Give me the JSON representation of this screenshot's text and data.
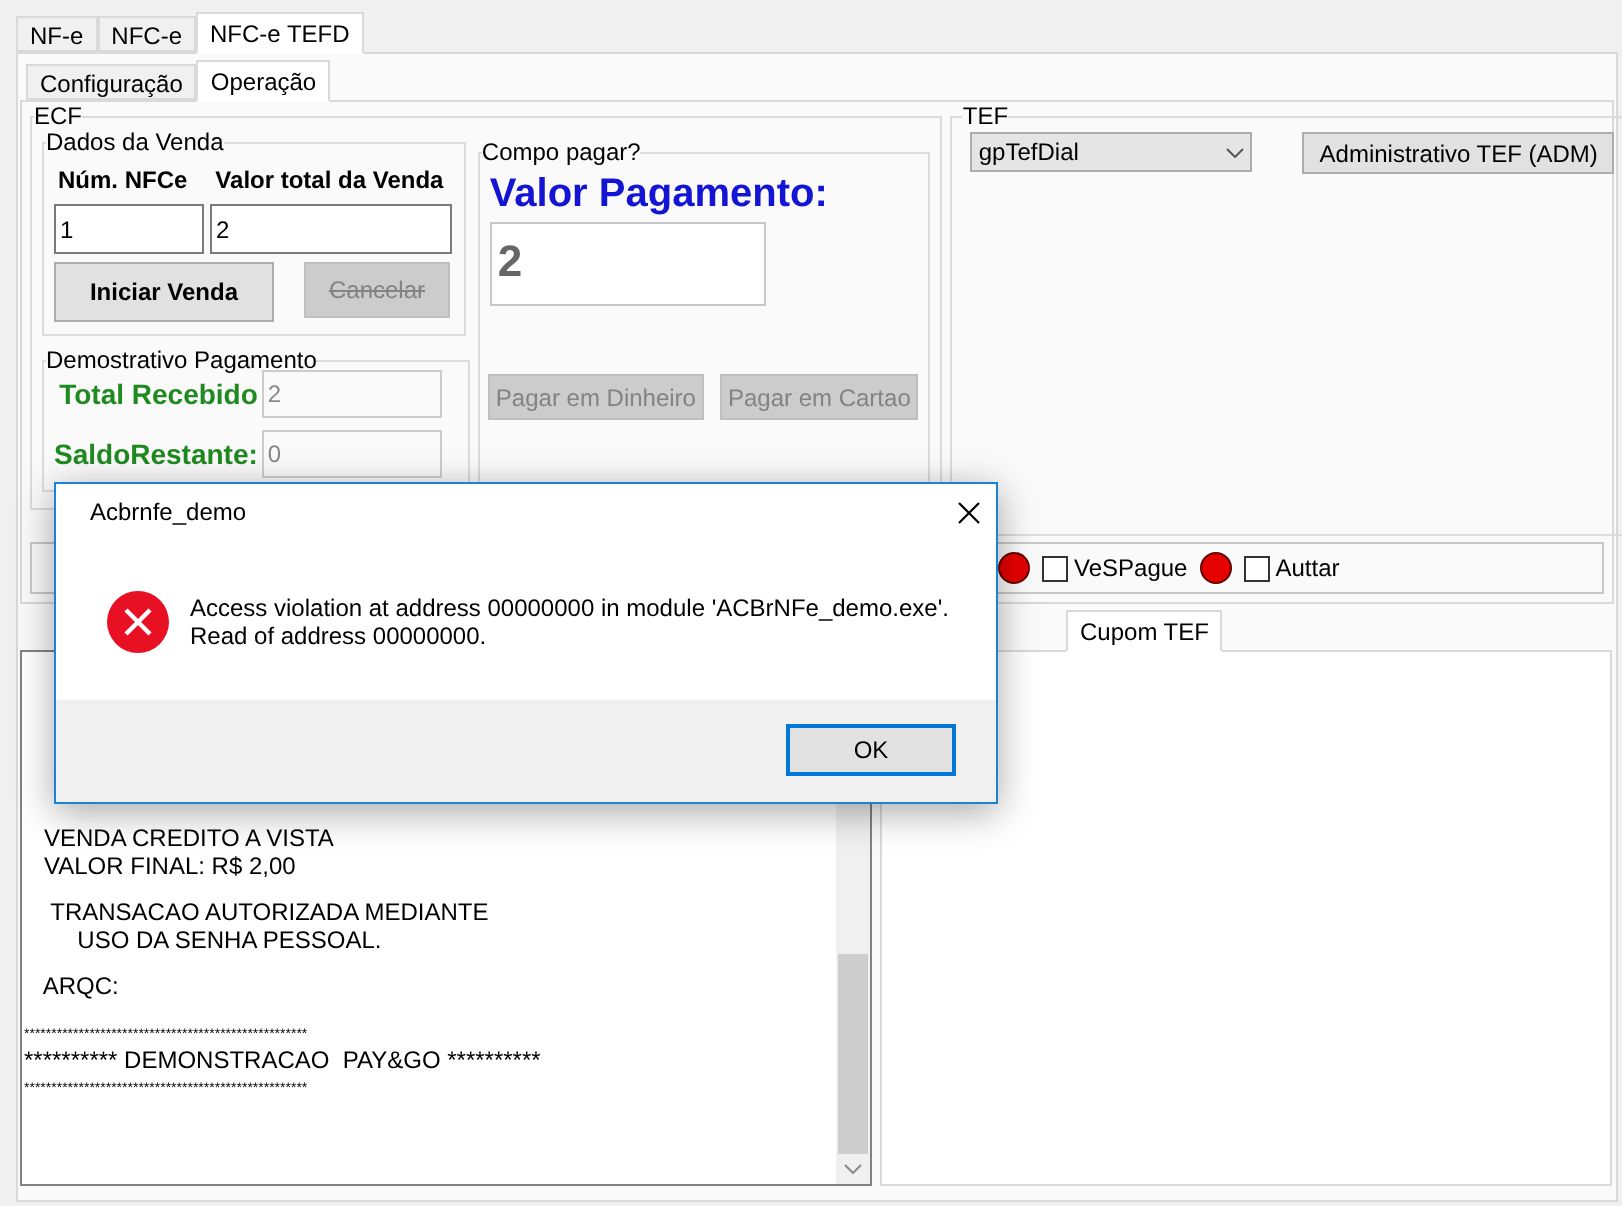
{
  "main_tabs": [
    {
      "label": "NF-e",
      "selected": false
    },
    {
      "label": "NFC-e",
      "selected": false
    },
    {
      "label": "NFC-e TEFD",
      "selected": true
    }
  ],
  "sub_tabs": [
    {
      "label": "Configuração",
      "selected": false
    },
    {
      "label": "Operação",
      "selected": true
    }
  ],
  "ecf": {
    "title": "ECF",
    "sale_data": {
      "title": "Dados da Venda",
      "num_label": "Núm. NFCe",
      "total_label": "Valor total da Venda",
      "num_value": "1",
      "total_value": "2",
      "buttons": [
        {
          "label": "Iniciar Venda",
          "disabled": false
        },
        {
          "label": "Cancelar",
          "disabled": true
        }
      ]
    },
    "payment_summary": {
      "title": "Demostrativo Pagamento",
      "fields": [
        {
          "label": "Total Recebido",
          "value": "2"
        },
        {
          "label": "SaldoRestante:",
          "value": "0"
        }
      ]
    },
    "how_to_pay": {
      "title": "Compo pagar?",
      "amount_label": "Valor Pagamento:",
      "amount": "2",
      "buttons": [
        {
          "label": "Pagar em Dinheiro",
          "disabled": true
        },
        {
          "label": "Pagar em Cartao",
          "disabled": true
        }
      ]
    }
  },
  "tef": {
    "title": "TEF",
    "select": "gpTefDial",
    "button": "Administrativo TEF (ADM)"
  },
  "status_row": [
    {
      "kind": "led",
      "color": "#e60000"
    },
    {
      "kind": "checkbox",
      "label": "VeSPague",
      "checked": false
    },
    {
      "kind": "led",
      "color": "#e60000"
    },
    {
      "kind": "checkbox",
      "label": "Auttar",
      "checked": false
    }
  ],
  "bottom_tabs": [
    {
      "label": "Cupom TEF",
      "selected": true
    }
  ],
  "receipt_blocks": [
    [
      "   VENDA CREDITO A VISTA",
      "   VALOR FINAL: R$ 2,00"
    ],
    [
      "    TRANSACAO AUTORIZADA MEDIANTE",
      "        USO DA SENHA PESSOAL."
    ],
    [
      "   ARQC:"
    ],
    [
      "****************************************************",
      "********** DEMONSTRACAO  PAY&GO **********",
      "****************************************************"
    ]
  ],
  "dialog": {
    "title": "Acbrnfe_demo",
    "message": [
      "Access violation at address 00000000 in module 'ACBrNFe_demo.exe'.",
      "Read of address 00000000."
    ],
    "button": "OK"
  }
}
